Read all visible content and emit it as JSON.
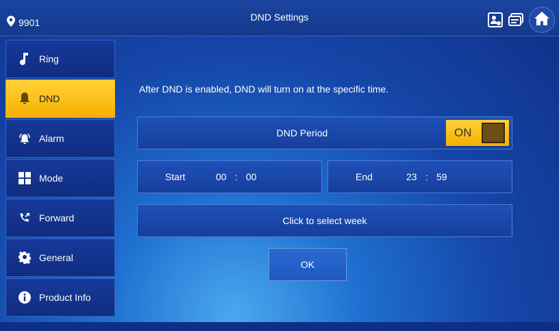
{
  "header": {
    "location_id": "9901",
    "title": "DND Settings"
  },
  "sidebar": {
    "items": [
      {
        "label": "Ring",
        "icon": "music-note-icon"
      },
      {
        "label": "DND",
        "icon": "bell-icon",
        "active": true
      },
      {
        "label": "Alarm",
        "icon": "alarm-bell-icon"
      },
      {
        "label": "Mode",
        "icon": "grid-icon"
      },
      {
        "label": "Forward",
        "icon": "phone-forward-icon"
      },
      {
        "label": "General",
        "icon": "gear-icon"
      },
      {
        "label": "Product Info",
        "icon": "info-icon"
      }
    ]
  },
  "main": {
    "info_text": "After DND is enabled, DND will turn on at the specific time.",
    "dnd_period_label": "DND Period",
    "toggle_state": "ON",
    "start_label": "Start",
    "start_hour": "00",
    "start_minute": "00",
    "end_label": "End",
    "end_hour": "23",
    "end_minute": "59",
    "time_separator": ":",
    "week_button": "Click to select week",
    "ok_button": "OK"
  },
  "colors": {
    "accent": "#f6b000",
    "panel": "#1546a8"
  }
}
